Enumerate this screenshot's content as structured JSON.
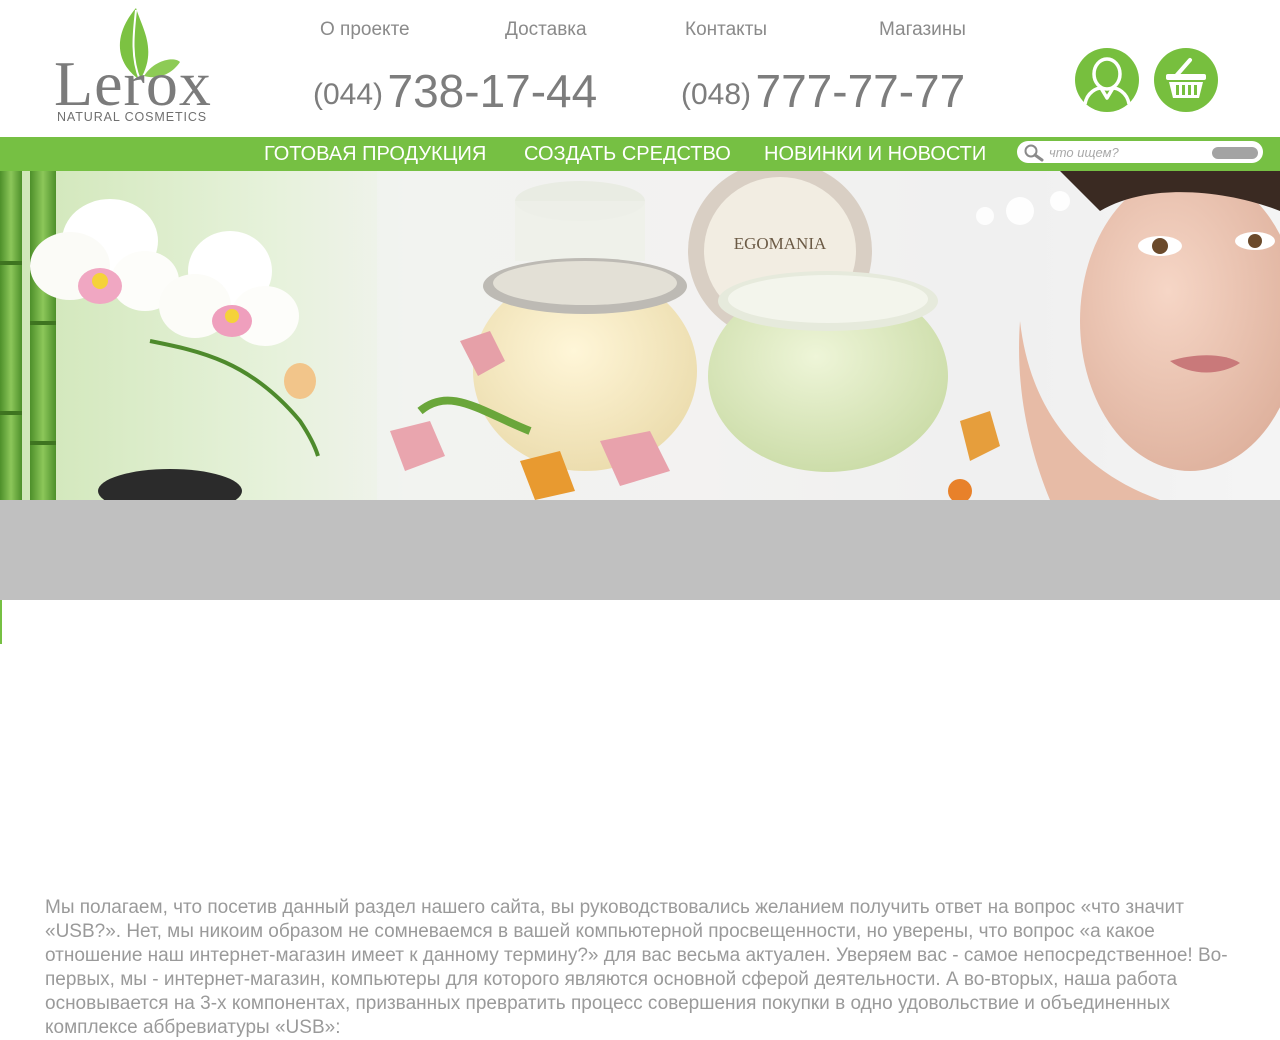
{
  "logo": {
    "word": "Lerox",
    "tagline": "NATURAL COSMETICS"
  },
  "top_nav": [
    {
      "label": "О проекте"
    },
    {
      "label": "Доставка"
    },
    {
      "label": "Контакты"
    },
    {
      "label": "Магазины"
    }
  ],
  "phones": [
    {
      "code": "(044)",
      "number": "738-17-44"
    },
    {
      "code": "(048)",
      "number": "777-77-77"
    }
  ],
  "icons": {
    "account": "user-icon",
    "cart": "basket-icon"
  },
  "main_nav": [
    {
      "label": "ГОТОВАЯ ПРОДУКЦИЯ"
    },
    {
      "label": "СОЗДАТЬ СРЕДСТВО"
    },
    {
      "label": "НОВИНКИ И НОВОСТИ"
    }
  ],
  "search": {
    "placeholder": "что ищем?"
  },
  "banner": {
    "jar_brand": "EGOMANIA"
  },
  "intro_text": " Мы полагаем, что посетив данный раздел нашего сайта, вы руководствовались желанием   получить ответ на вопрос «что значит «USB?». Нет, мы никоим образом не сомневаемся в вашей компьютерной просвещенности, но уверены, что вопрос «а какое отношение наш интернет-магазин имеет к данному термину?» для вас весьма актуален. Уверяем вас - самое непосредственное!  Во-первых, мы - интернет-магазин, компьютеры для которого являются основной сферой деятельности. А во-вторых, наша работа основывается на 3-х компонентах, призванных превратить процесс совершения покупки в одно удовольствие и объединенных комплексе аббревиатуры «USB»:",
  "colors": {
    "accent": "#76c043",
    "text_gray": "#8a8a8a",
    "band_gray": "#c0c0c0"
  }
}
